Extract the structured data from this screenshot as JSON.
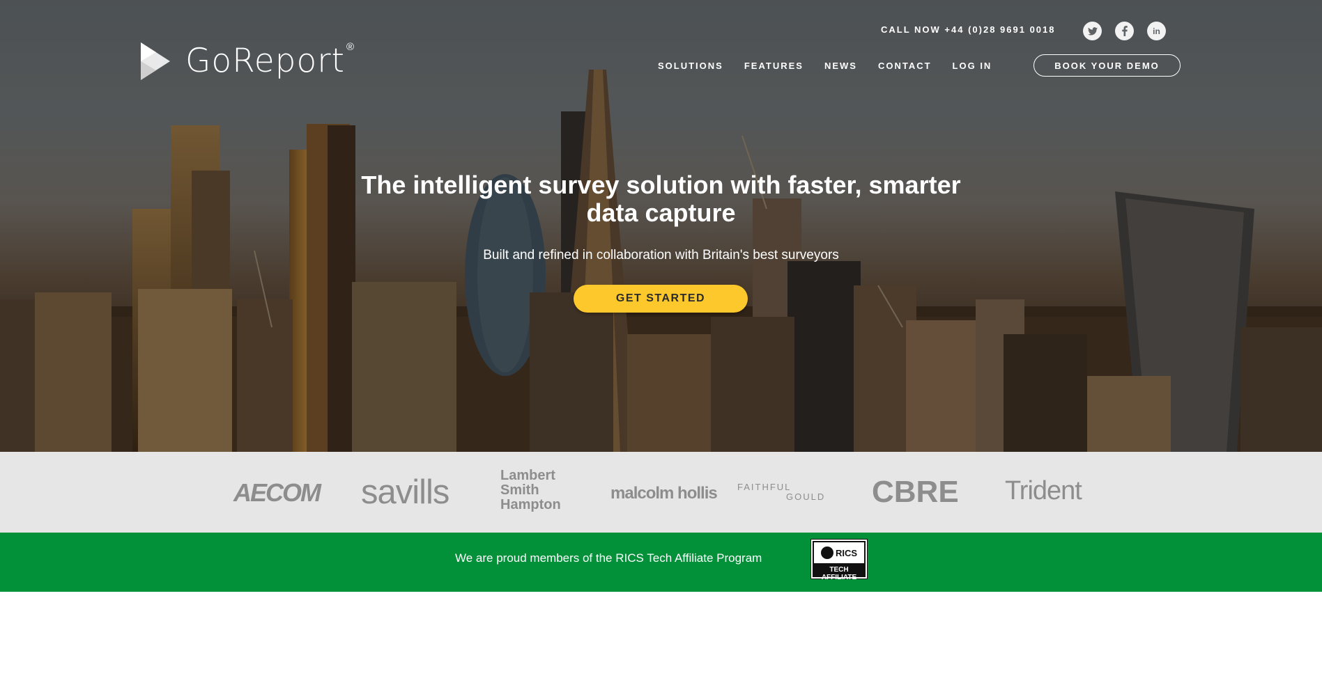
{
  "header": {
    "logo_text": "GoReport",
    "logo_reg": "®",
    "call_now": "CALL NOW +44 (0)28 9691 0018",
    "social": {
      "twitter": "twitter-icon",
      "facebook": "facebook-icon",
      "linkedin": "linkedin-icon"
    },
    "nav": [
      "SOLUTIONS",
      "FEATURES",
      "NEWS",
      "CONTACT",
      "LOG IN"
    ],
    "demo_button": "BOOK YOUR DEMO"
  },
  "hero": {
    "headline_line1": "The intelligent survey solution with faster, smarter",
    "headline_line2": "data capture",
    "subline": "Built and refined in collaboration with Britain's best surveyors",
    "cta": "GET STARTED",
    "cta_color": "#fcc82b"
  },
  "clients": {
    "aecom": "AECOM",
    "savills": "savills",
    "lsh_1": "Lambert",
    "lsh_2": "Smith",
    "lsh_3": "Hampton",
    "malcolm": "malcolm hollis",
    "faithful_1": "FAITHFUL",
    "faithful_2": "GOULD",
    "cbre": "CBRE",
    "trident": "Trident"
  },
  "rics": {
    "text": "We are proud members of the RICS Tech Affiliate Program",
    "badge_top": "RICS",
    "badge_bottom": "TECH AFFILIATE",
    "bar_color": "#029139"
  }
}
